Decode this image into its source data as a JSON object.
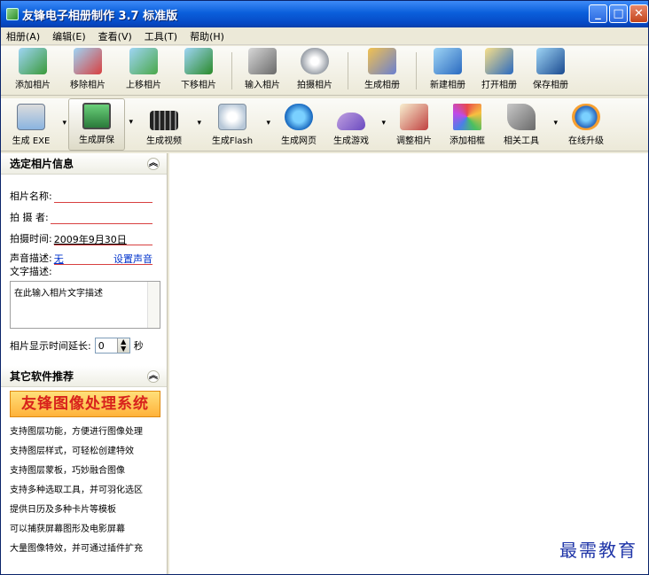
{
  "window": {
    "title": "友锋电子相册制作 3.7 标准版"
  },
  "menu": [
    "相册(A)",
    "编辑(E)",
    "查看(V)",
    "工具(T)",
    "帮助(H)"
  ],
  "toolbar1": [
    {
      "label": "添加相片",
      "icon": "add-photo-icon"
    },
    {
      "label": "移除相片",
      "icon": "remove-photo-icon"
    },
    {
      "label": "上移相片",
      "icon": "move-up-photo-icon"
    },
    {
      "label": "下移相片",
      "icon": "move-down-photo-icon"
    },
    {
      "label": "输入相片",
      "icon": "import-photo-icon"
    },
    {
      "label": "拍摄相片",
      "icon": "webcam-icon"
    },
    {
      "label": "生成相册",
      "icon": "build-album-icon"
    },
    {
      "label": "新建相册",
      "icon": "new-album-icon"
    },
    {
      "label": "打开相册",
      "icon": "open-album-icon"
    },
    {
      "label": "保存相册",
      "icon": "save-album-icon"
    }
  ],
  "toolbar2": [
    {
      "label": "生成 EXE",
      "icon": "exe-icon"
    },
    {
      "label": "生成屏保",
      "icon": "screensaver-icon"
    },
    {
      "label": "生成视频",
      "icon": "video-icon"
    },
    {
      "label": "生成Flash",
      "icon": "flash-icon"
    },
    {
      "label": "生成网页",
      "icon": "webpage-icon"
    },
    {
      "label": "生成游戏",
      "icon": "game-icon"
    },
    {
      "label": "调整相片",
      "icon": "adjust-photo-icon"
    },
    {
      "label": "添加相框",
      "icon": "frame-icon"
    },
    {
      "label": "相关工具",
      "icon": "tools-icon"
    },
    {
      "label": "在线升级",
      "icon": "upgrade-icon"
    }
  ],
  "photo_info": {
    "header": "选定相片信息",
    "name_label": "相片名称:",
    "name_value": "",
    "photographer_label": "拍 摄 者:",
    "photographer_value": "",
    "date_label": "拍摄时间:",
    "date_value": "2009年9月30日",
    "sound_label": "声音描述:",
    "sound_value": "无",
    "set_sound": "设置声音",
    "text_label": "文字描述:",
    "text_placeholder": "在此输入相片文字描述",
    "delay_label": "相片显示时间延长:",
    "delay_value": "0",
    "delay_unit": "秒"
  },
  "recommend": {
    "header": "其它软件推荐",
    "banner": "友锋图像处理系统",
    "lines": [
      "支持图层功能，方便进行图像处理",
      "支持图层样式，可轻松创建特效",
      "支持图层蒙板，巧妙融合图像",
      "支持多种选取工具，并可羽化选区",
      "提供日历及多种卡片等模板",
      "可以捕获屏幕图形及电影屏幕",
      "大量图像特效，并可通过插件扩充"
    ]
  },
  "watermark": "最需教育"
}
